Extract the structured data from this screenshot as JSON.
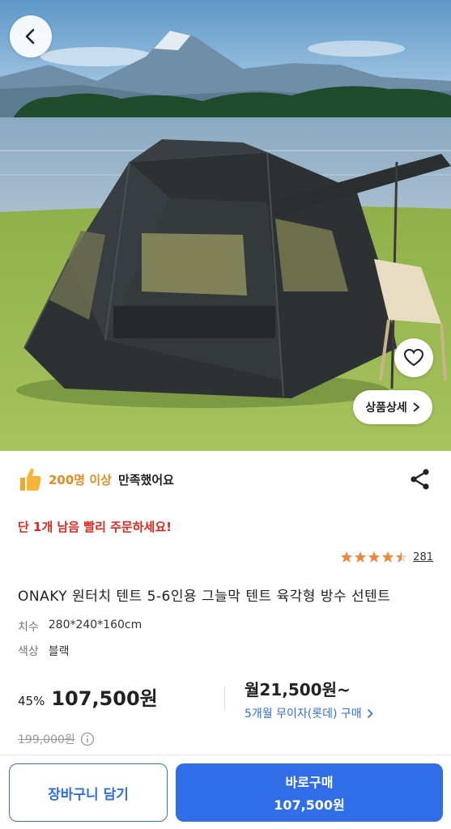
{
  "satisfaction": {
    "highlight": "200명 이상",
    "rest": "만족했어요"
  },
  "urgency": "단 1개 남음 빨리 주문하세요!",
  "rating": {
    "stars": 4.5,
    "review_count": "281"
  },
  "product": {
    "title": "ONAKY 원터치 텐트 5-6인용 그늘막 텐트 육각형 방수 선텐트",
    "options": [
      {
        "key": "치수",
        "value": "280*240*160cm"
      },
      {
        "key": "색상",
        "value": "블랙"
      }
    ]
  },
  "price": {
    "discount": "45%",
    "current": "107,500원",
    "original": "199,000원",
    "monthly": "월21,500원~",
    "installment": "5개월 무이자(롯데) 구매"
  },
  "hero": {
    "detail_label": "상품상세"
  },
  "bottom": {
    "cart_label": "장바구니 담기",
    "buy_label": "바로구매",
    "buy_price": "107,500원"
  },
  "colors": {
    "accent": "#2f6ee6",
    "urgent": "#e0251e",
    "highlight": "#e58a1f",
    "star": "#f0863a"
  }
}
